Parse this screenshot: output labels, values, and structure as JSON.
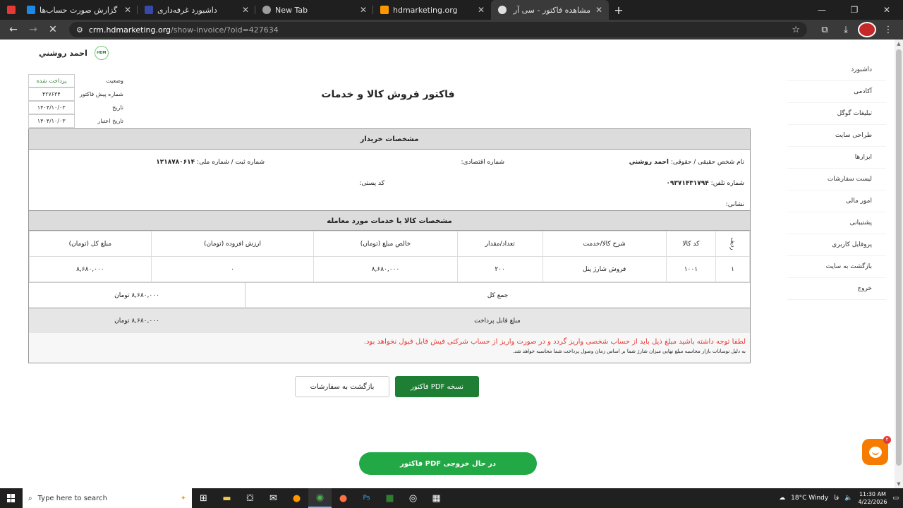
{
  "browser": {
    "tabs": [
      {
        "title": "",
        "color": "#e53935",
        "active": false
      },
      {
        "title": "گزارش صورت حساب‌ها",
        "color": "#1e88e5",
        "active": false
      },
      {
        "title": "داشبورد غرفه‌داری",
        "color": "#3949ab",
        "active": false
      },
      {
        "title": "New Tab",
        "color": "#9e9e9e",
        "active": false
      },
      {
        "title": "hdmarketing.org",
        "color": "#ff9800",
        "active": false
      },
      {
        "title": "مشاهده فاکتور - سی آر ام HDM",
        "color": "#e0e0e0",
        "active": true
      }
    ],
    "url_host": "crm.hdmarketing.org",
    "url_path": "/show-invoice/?oid=427634"
  },
  "user": {
    "name": "احمد روشني",
    "logo_text": "HDM"
  },
  "sidebar": {
    "items": [
      "داشبورد",
      "آکادمی",
      "تبلیغات گوگل",
      "طراحی سایت",
      "ابزارها",
      "لیست سفارشات",
      "امور مالی",
      "پشتیبانی",
      "پروفایل کاربری",
      "بازگشت به سایت",
      "خروج"
    ]
  },
  "meta": {
    "status_label": "وضعیت",
    "status_value": "پرداخت شده",
    "preinvoice_label": "شماره پیش فاکتور",
    "preinvoice_value": "۴۲۷۶۳۴",
    "date_label": "تاریخ",
    "date_value": "۱۴۰۴/۱۰/۰۳",
    "validity_label": "تاریخ اعتبار",
    "validity_value": "۱۴۰۴/۱۰/۰۳"
  },
  "invoice": {
    "title": "فاکتور فروش کالا و خدمات",
    "buyer_heading": "مشخصات خریدار",
    "buyer": {
      "name_label": "نام شخص حقیقی / حقوقی:",
      "name_value": "احمد روشني",
      "econ_label": "شماره اقتصادی:",
      "reg_label": "شماره ثبت / شماره ملی:",
      "reg_value": "۱۲۱۸۷۸۰۶۱۴",
      "phone_label": "شماره تلفن:",
      "phone_value": "۰۹۳۷۱۴۳۱۷۹۴",
      "postal_label": "کد پستی:",
      "address_label": "نشانی:"
    },
    "items_heading": "مشخصات کالا یا خدمات مورد معامله",
    "columns": [
      "ردیف",
      "کد کالا",
      "شرح کالا/خدمت",
      "تعداد/مقدار",
      "خالص مبلغ (تومان)",
      "ارزش افزوده (تومان)",
      "مبلغ کل (تومان)"
    ],
    "rows": [
      [
        "۱",
        "۱۰۰۱",
        "فروش شارژ پنل",
        "۲۰۰",
        "۸,۶۸۰,۰۰۰",
        "۰",
        "۸,۶۸۰,۰۰۰"
      ]
    ],
    "total_label": "جمع کل",
    "total_value": "۸,۶۸۰,۰۰۰ تومان",
    "payable_label": "مبلغ قابل پرداخت",
    "payable_value": "۸,۶۸۰,۰۰۰ تومان",
    "note_red": "لطفا توجه داشته باشید مبلغ ذیل باید از حساب شخصی واریز گردد و در صورت واریز از حساب شرکتی فیش قابل قبول نخواهد بود.",
    "note_small": "به دلیل نوسانات بازار محاسبه مبلغ نهایی میزان شارژ شما بر اساس زمان وصول پرداخت شما محاسبه خواهد شد."
  },
  "buttons": {
    "pdf": "نسخه PDF فاکتور",
    "back": "بازگشت به سفارشات"
  },
  "progress_text": "در حال خروجی PDF فاکتور",
  "chat_badge": "۲",
  "taskbar": {
    "search_placeholder": "Type here to search",
    "weather": "18°C  Windy",
    "lang": "فا",
    "time": "11:30 AM",
    "date": "4/22/2026"
  }
}
